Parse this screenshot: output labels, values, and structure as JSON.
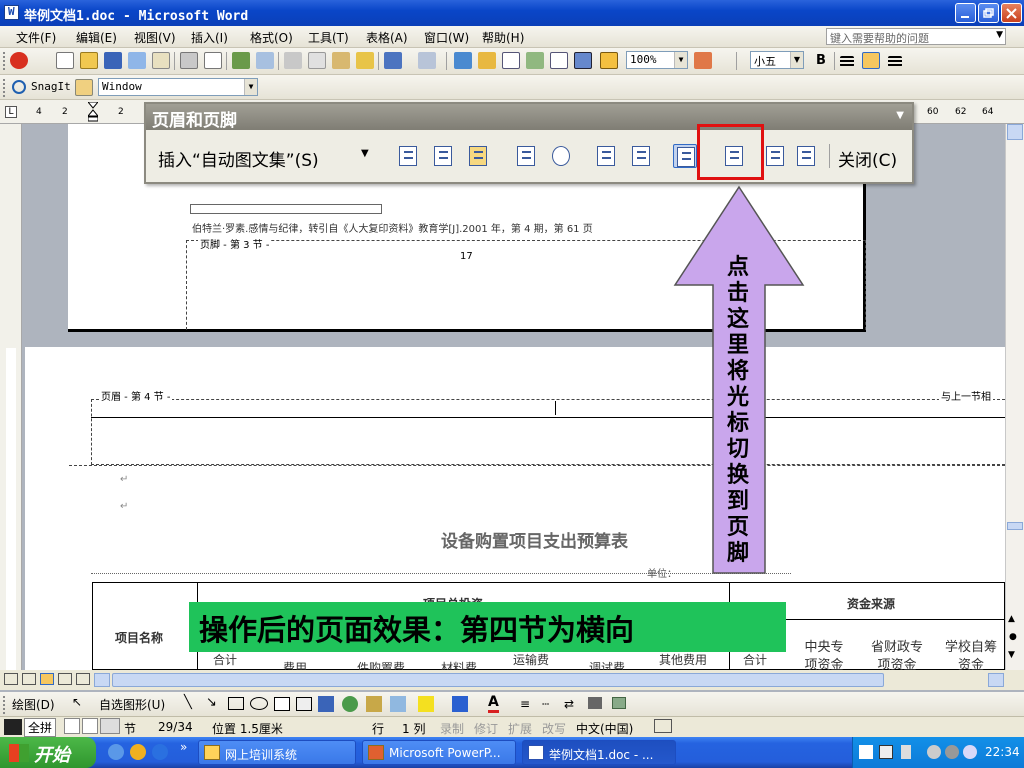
{
  "titlebar": {
    "title": "举例文档1.doc - Microsoft Word"
  },
  "menubar": {
    "items": [
      "文件(F)",
      "编辑(E)",
      "视图(V)",
      "插入(I)",
      "格式(O)",
      "工具(T)",
      "表格(A)",
      "窗口(W)",
      "帮助(H)"
    ],
    "help_placeholder": "键入需要帮助的问题"
  },
  "toolbar": {
    "zoom": "100%",
    "font_size": "小五",
    "bold": "B"
  },
  "toolbar2": {
    "snagit": "SnagIt",
    "window_combo": "Window"
  },
  "ruler": {
    "left_ticks": [
      "4",
      "2",
      "2"
    ],
    "right_ticks": [
      "60",
      "62",
      "64"
    ]
  },
  "hf_toolbar": {
    "title": "页眉和页脚",
    "insert_autotext": "插入“自动图文集”(S)",
    "close": "关闭(C)"
  },
  "page1": {
    "footnote": "伯特兰·罗素.感情与纪律，转引自《人大复印资料》教育学[J].2001 年，第 4 期，第 61 页",
    "footer_label": "页脚 - 第 3 节 -",
    "page_number": "17"
  },
  "page2": {
    "header_label": "页眉 - 第 4 节 -",
    "same_as_prev": "与上一节相",
    "doc_title": "设备购置项目支出预算表",
    "unit_label": "单位：",
    "table": {
      "project_name": "项目名称",
      "total_invest": "项目总投资",
      "funding_source": "资金来源",
      "subheads": [
        "合计",
        "费用",
        "件购置费",
        "材料费",
        "运输费",
        "调试费",
        "其他费用",
        "合计",
        "中央专项资金",
        "省财政专项资金",
        "学校自筹资金"
      ]
    }
  },
  "annotation": {
    "arrow_text": "点击这里将光标切换到页脚",
    "green_text": "操作后的页面效果：第四节为横向"
  },
  "drawbar": {
    "draw": "绘图(D)",
    "autoshape": "自选图形(U)"
  },
  "statusbar": {
    "ime": "全拼",
    "section": "节",
    "page_of": "29/34",
    "position": "位置 1.5厘米",
    "row": "行",
    "col": "1 列",
    "rec": "录制",
    "trk": "修订",
    "ext": "扩展",
    "ovr": "改写",
    "lang": "中文(中国)"
  },
  "taskbar": {
    "start": "开始",
    "tasks": [
      "网上培训系统",
      "Microsoft PowerP...",
      "举例文档1.doc - ..."
    ],
    "time": "22:34"
  },
  "colors": {
    "title_blue": "#0a46c8",
    "green_box": "#1fc35a",
    "arrow_fill": "#c9a6ec",
    "highlight_red": "#e01010"
  }
}
